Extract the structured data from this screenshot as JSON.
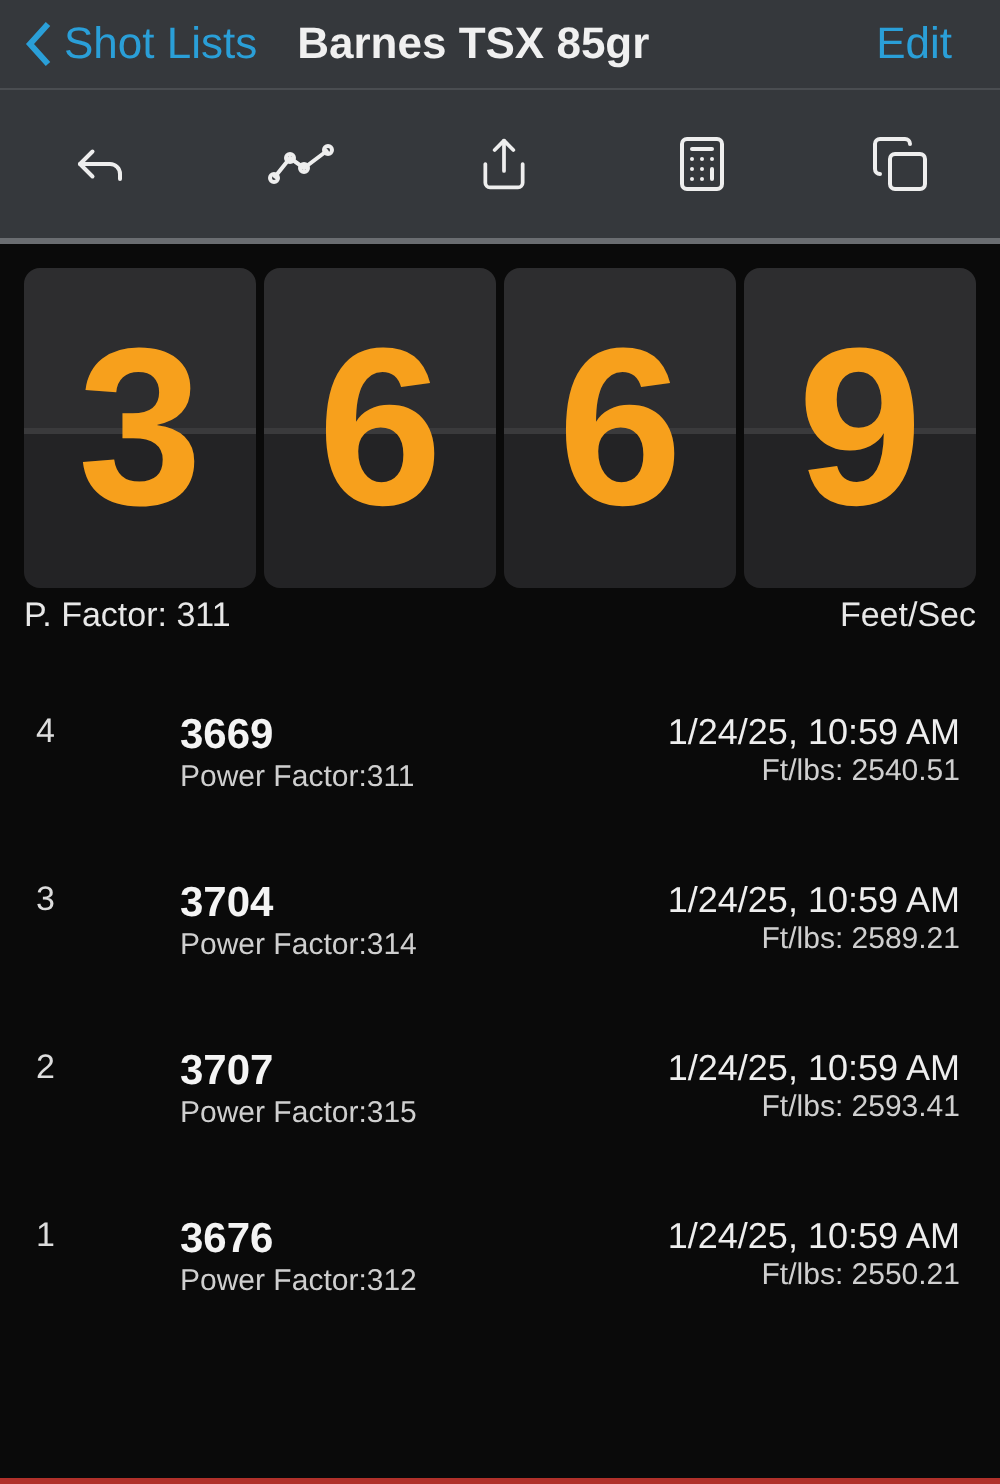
{
  "nav": {
    "back": "Shot Lists",
    "title": "Barnes TSX 85gr",
    "action": "Edit"
  },
  "toolbar": [
    {
      "kind": "reply"
    },
    {
      "kind": "chart"
    },
    {
      "kind": "share"
    },
    {
      "kind": "calculator"
    },
    {
      "kind": "copy"
    }
  ],
  "display": {
    "digits": [
      "3",
      "6",
      "6",
      "9"
    ],
    "left_label": "P. Factor: 311",
    "right_label": "Feet/Sec"
  },
  "shots": [
    {
      "index": "4",
      "velocity": "3669",
      "power_factor": "Power Factor:311",
      "time": "1/24/25, 10:59 AM",
      "energy": "Ft/lbs: 2540.51"
    },
    {
      "index": "3",
      "velocity": "3704",
      "power_factor": "Power Factor:314",
      "time": "1/24/25, 10:59 AM",
      "energy": "Ft/lbs: 2589.21"
    },
    {
      "index": "2",
      "velocity": "3707",
      "power_factor": "Power Factor:315",
      "time": "1/24/25, 10:59 AM",
      "energy": "Ft/lbs: 2593.41"
    },
    {
      "index": "1",
      "velocity": "3676",
      "power_factor": "Power Factor:312",
      "time": "1/24/25, 10:59 AM",
      "energy": "Ft/lbs: 2550.21"
    }
  ]
}
